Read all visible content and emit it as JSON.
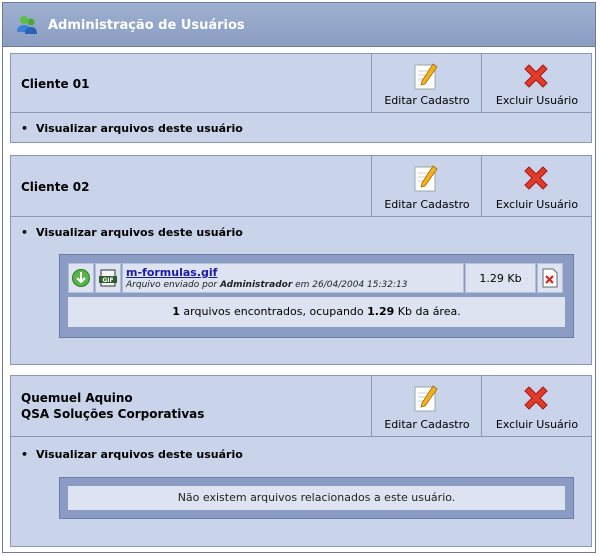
{
  "header": {
    "title": "Administração de Usuários",
    "icon": "users-icon"
  },
  "actions": {
    "edit_label": "Editar Cadastro",
    "delete_label": "Excluir Usuário"
  },
  "view_files_label": "Visualizar arquivos deste usuário",
  "clients": [
    {
      "name_line1": "Cliente 01",
      "name_line2": ""
    },
    {
      "name_line1": "Cliente 02",
      "name_line2": "",
      "files": [
        {
          "filename": "m-formulas.gif",
          "sent_prefix": "Arquivo enviado por",
          "sent_by": "Administrador",
          "sent_suffix": "em 26/04/2004 15:32:13",
          "size": "1.29 Kb"
        }
      ],
      "summary": {
        "count": "1",
        "middle": "arquivos encontrados, ocupando",
        "size": "1.29",
        "suffix": "Kb da área."
      }
    },
    {
      "name_line1": "Quemuel Aquino",
      "name_line2": "QSA Soluções Corporativas",
      "no_files_message": "Não existem arquivos relacionados a este usuário."
    }
  ],
  "colors": {
    "header": "#8fa2c8",
    "panel": "#c9d3ea",
    "link": "#1a1aa6"
  }
}
